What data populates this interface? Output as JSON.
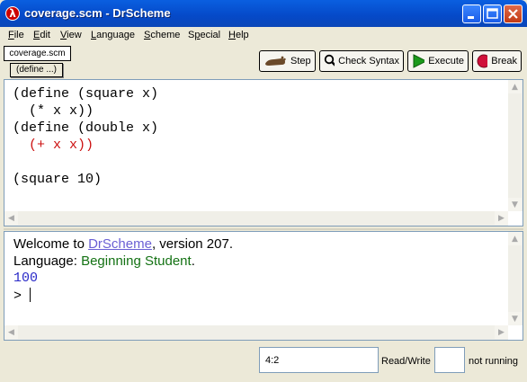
{
  "window": {
    "title": "coverage.scm - DrScheme",
    "app_icon_glyph": "λ"
  },
  "menu": [
    {
      "pre": "",
      "u": "F",
      "post": "ile"
    },
    {
      "pre": "",
      "u": "E",
      "post": "dit"
    },
    {
      "pre": "",
      "u": "V",
      "post": "iew"
    },
    {
      "pre": "",
      "u": "L",
      "post": "anguage"
    },
    {
      "pre": "",
      "u": "S",
      "post": "cheme"
    },
    {
      "pre": "S",
      "u": "p",
      "post": "ecial"
    },
    {
      "pre": "",
      "u": "H",
      "post": "elp"
    }
  ],
  "file_tab": "coverage.scm",
  "define_menu": "(define ...)",
  "toolbar": {
    "step": "Step",
    "check_syntax": "Check Syntax",
    "execute": "Execute",
    "break": "Break"
  },
  "editor": {
    "lines": [
      {
        "text": "(define (square x)",
        "style": "normal"
      },
      {
        "text": "  (* x x))",
        "style": "normal"
      },
      {
        "text": "(define (double x)",
        "style": "normal"
      },
      {
        "text": "  (+ x x))",
        "style": "uncovered"
      },
      {
        "text": "",
        "style": "normal"
      },
      {
        "text": "(square 10)",
        "style": "normal"
      }
    ]
  },
  "repl": {
    "welcome_pre": "Welcome to ",
    "welcome_link": "DrScheme",
    "welcome_post": ", version 207.",
    "language_label": "Language: ",
    "language_value": "Beginning Student",
    "language_post": ".",
    "result": "100",
    "prompt": ">"
  },
  "status": {
    "position": "4:2",
    "mode": "Read/Write",
    "running": "not running"
  },
  "colors": {
    "uncovered_code": "#cc1111",
    "language_name": "#147214",
    "link": "#6a5fd4",
    "result": "#2a2ac8"
  }
}
